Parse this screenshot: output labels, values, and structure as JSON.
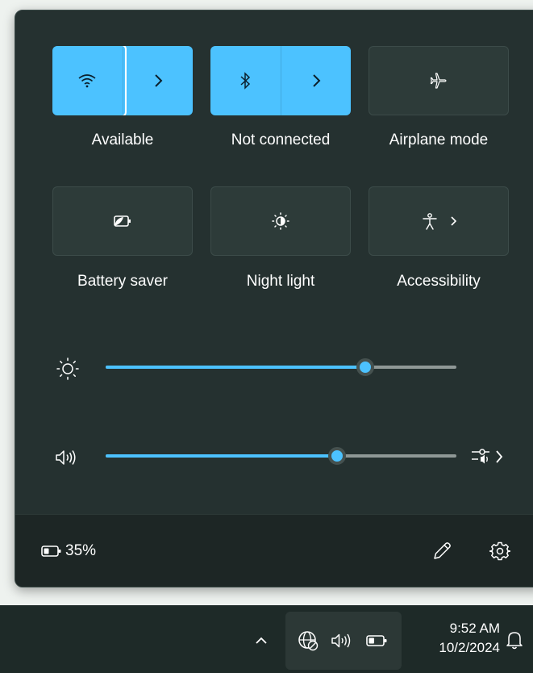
{
  "quick_settings": {
    "tiles": [
      {
        "label": "Available",
        "icon": "wifi-icon",
        "state": "on",
        "has_chevron": true
      },
      {
        "label": "Not connected",
        "icon": "bluetooth-icon",
        "state": "on",
        "has_chevron": true
      },
      {
        "label": "Airplane mode",
        "icon": "airplane-icon",
        "state": "off"
      },
      {
        "label": "Battery saver",
        "icon": "battery-saver-icon",
        "state": "off"
      },
      {
        "label": "Night light",
        "icon": "night-light-icon",
        "state": "off"
      },
      {
        "label": "Accessibility",
        "icon": "accessibility-icon",
        "state": "off",
        "has_chevron": true
      }
    ],
    "brightness": {
      "icon": "sun-icon",
      "level_percent": 74
    },
    "volume": {
      "icon": "speaker-icon",
      "level_percent": 66,
      "mixer_icon": "audio-mixer-icon"
    },
    "battery": {
      "text": "35%",
      "icon": "battery-icon"
    },
    "edit_icon": "pencil-icon",
    "settings_icon": "gear-icon"
  },
  "taskbar": {
    "overflow_icon": "chevron-up-icon",
    "tray_icons": [
      "network-icon",
      "speaker-icon",
      "battery-icon"
    ],
    "time": "9:52 AM",
    "date": "10/2/2024",
    "notification_icon": "bell-icon"
  },
  "colors": {
    "accent": "#4cc2ff",
    "panel": "#253130",
    "taskbar": "#1e2a28"
  }
}
